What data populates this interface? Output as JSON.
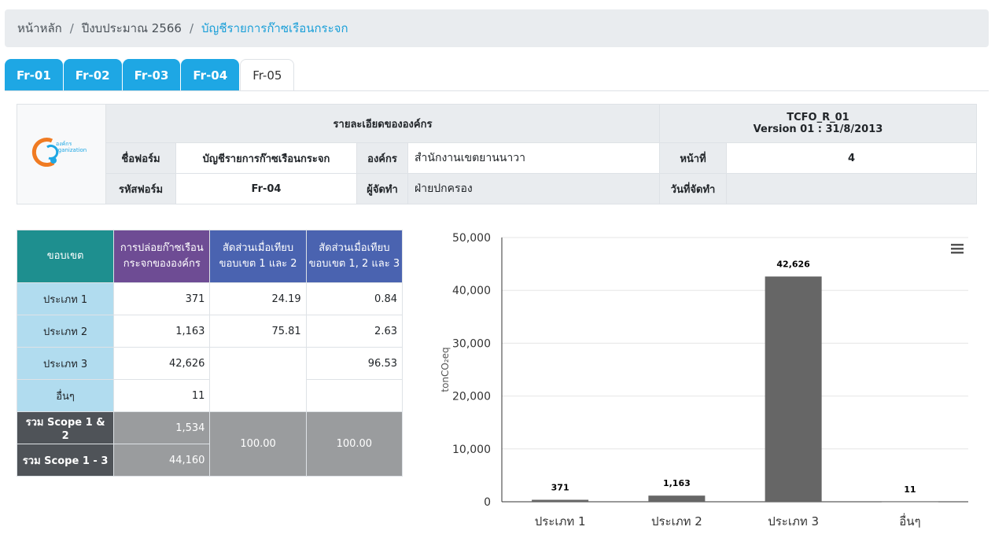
{
  "breadcrumb": {
    "home": "หน้าหลัก",
    "year": "ปีงบประมาณ 2566",
    "current": "บัญชีรายการก๊าซเรือนกระจก"
  },
  "tabs": [
    "Fr-01",
    "Fr-02",
    "Fr-03",
    "Fr-04",
    "Fr-05"
  ],
  "header": {
    "logo_text": "องค์กร Organization",
    "title": "รายละเอียดขององค์กร",
    "code": "TCFO_R_01",
    "version": "Version 01 : 31/8/2013",
    "form_name_label": "ชื่อฟอร์ม",
    "form_name": "บัญชีรายการก๊าซเรือนกระจก",
    "org_label": "องค์กร",
    "org": "สำนักงานเขตยานนาวา",
    "page_label": "หน้าที่",
    "page": "4",
    "form_code_label": "รหัสฟอร์ม",
    "form_code": "Fr-04",
    "preparer_label": "ผู้จัดทำ",
    "preparer": "ฝ่ายปกครอง",
    "date_label": "วันที่จัดทำ",
    "date": ""
  },
  "table": {
    "col1": "ขอบเขต",
    "col2_line1": "การปล่อยก๊าซเรือน",
    "col2_line2": "กระจกขององค์กร",
    "col3_line1": "สัดส่วนเมื่อเทียบ",
    "col3_line2": "ขอบเขต 1 และ 2",
    "col4_line1": "สัดส่วนเมื่อเทียบ",
    "col4_line2": "ขอบเขต 1, 2 และ 3",
    "rows": [
      {
        "label": "ประเภท 1",
        "emission": "371",
        "pct12": "24.19",
        "pct123": "0.84"
      },
      {
        "label": "ประเภท 2",
        "emission": "1,163",
        "pct12": "75.81",
        "pct123": "2.63"
      },
      {
        "label": "ประเภท 3",
        "emission": "42,626",
        "pct12": "",
        "pct123": "96.53"
      },
      {
        "label": "อื่นๆ",
        "emission": "11",
        "pct12": "",
        "pct123": ""
      }
    ],
    "sum12_label": "รวม Scope 1 & 2",
    "sum12_value": "1,534",
    "sum13_label": "รวม Scope 1 - 3",
    "sum13_value": "44,160",
    "sum_pct12": "100.00",
    "sum_pct123": "100.00"
  },
  "chart_data": {
    "type": "bar",
    "categories": [
      "ประเภท 1",
      "ประเภท 2",
      "ประเภท 3",
      "อื่นๆ"
    ],
    "values": [
      371,
      1163,
      42626,
      11
    ],
    "data_labels": [
      "371",
      "1,163",
      "42,626",
      "11"
    ],
    "ylabel": "tonCO₂eq",
    "ylim": [
      0,
      50000
    ],
    "yticks": [
      "0",
      "10,000",
      "20,000",
      "30,000",
      "40,000",
      "50,000"
    ],
    "bar_color": "#666666",
    "grid": true,
    "menu_icon": "hamburger-menu-icon"
  }
}
